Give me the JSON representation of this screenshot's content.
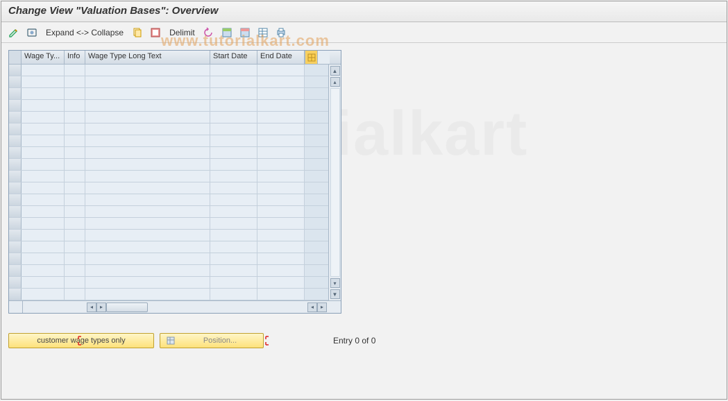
{
  "title": "Change View \"Valuation Bases\": Overview",
  "watermark": "www.tutorialkart.com",
  "watermark_faded": "ialkart",
  "toolbar": {
    "expand_collapse": "Expand <-> Collapse",
    "delimit": "Delimit"
  },
  "grid": {
    "columns": {
      "wage_type": "Wage Ty...",
      "info": "Info",
      "long_text": "Wage Type Long Text",
      "start_date": "Start Date",
      "end_date": "End Date"
    },
    "row_count": 20
  },
  "buttons": {
    "customer_filter": "customer wage types only",
    "position": "Position..."
  },
  "status": {
    "entry_text": "Entry 0 of 0"
  }
}
